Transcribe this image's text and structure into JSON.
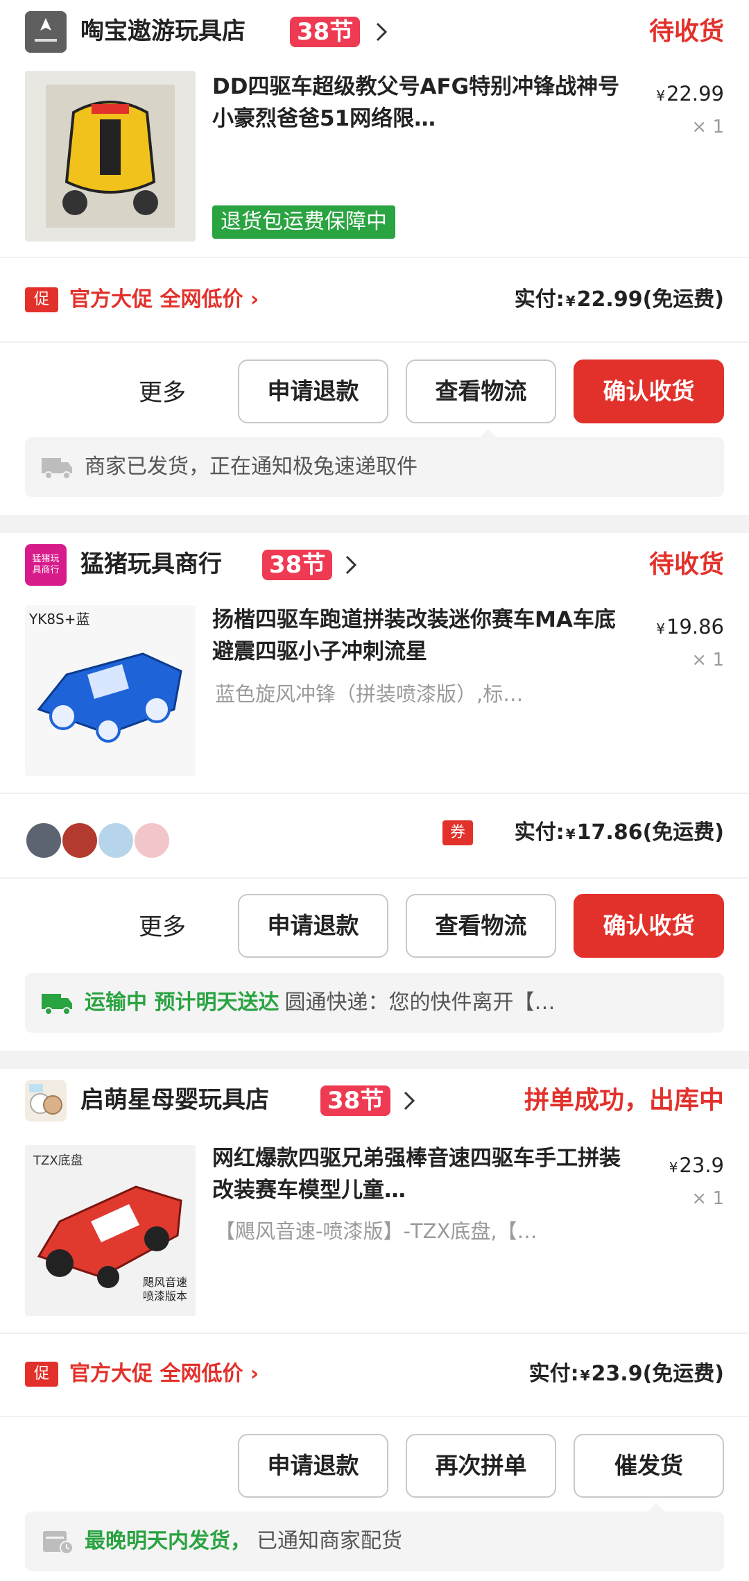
{
  "orders": [
    {
      "shop_name": "啕宝遨游玩具店",
      "festival_badge": "38节",
      "status": "待收货",
      "product_title": "DD四驱车超级教父号AFG特别冲锋战神号小豪烈爸爸51网络限…",
      "product_spec": "",
      "price": "22.99",
      "quantity": "× 1",
      "guarantee_tag": "退货包运费保障中",
      "promo_icon": "促",
      "promo_text": "官方大促 全网低价 ›",
      "paid_label": "实付:",
      "paid_amount": "22.99",
      "shipping_note": "(免运费)",
      "actions": {
        "more": "更多",
        "btn1": "申请退款",
        "btn2": "查看物流",
        "btn3": "确认收货"
      },
      "delivery_icon": "truck-icon",
      "delivery_highlight": "",
      "delivery_text": "商家已发货，正在通知极兔速递取件"
    },
    {
      "shop_name": "猛猪玩具商行",
      "shop_logo_text": "猛猪玩具商行",
      "festival_badge": "38节",
      "status": "待收货",
      "image_caption": "YK8S+蓝",
      "product_title": "扬楷四驱车跑道拼装改装迷你赛车MA车底避震四驱小子冲刺流星",
      "product_spec": "蓝色旋风冲锋（拼装喷漆版）,标…",
      "price": "19.86",
      "quantity": "× 1",
      "coupon_icon": "券",
      "paid_label": "实付:",
      "paid_amount": "17.86",
      "shipping_note": "(免运费)",
      "actions": {
        "more": "更多",
        "btn1": "申请退款",
        "btn2": "查看物流",
        "btn3": "确认收货"
      },
      "delivery_icon": "truck-icon",
      "delivery_highlight": "运输中 预计明天送达",
      "delivery_text": "圆通快递：您的快件离开【…"
    },
    {
      "shop_name": "启萌星母婴玩具店",
      "festival_badge": "38节",
      "status": "拼单成功，出库中",
      "image_caption": "TZX底盘",
      "image_subcaption": "飓风音速\n喷漆版本",
      "product_title": "网红爆款四驱兄弟强棒音速四驱车手工拼装改装赛车模型儿童…",
      "product_spec": "【飓风音速-喷漆版】-TZX底盘,【…",
      "price": "23.9",
      "quantity": "× 1",
      "promo_icon": "促",
      "promo_text": "官方大促 全网低价 ›",
      "paid_label": "实付:",
      "paid_amount": "23.9",
      "shipping_note": "(免运费)",
      "actions": {
        "btn1": "申请退款",
        "btn2": "再次拼单",
        "btn3": "催发货"
      },
      "delivery_icon": "calendar-clock-icon",
      "delivery_highlight": "最晚明天内发货，",
      "delivery_text": "已通知商家配货"
    }
  ],
  "colors": {
    "accent": "#e2312b",
    "festival": "#ee3a52",
    "green": "#2aa341"
  }
}
